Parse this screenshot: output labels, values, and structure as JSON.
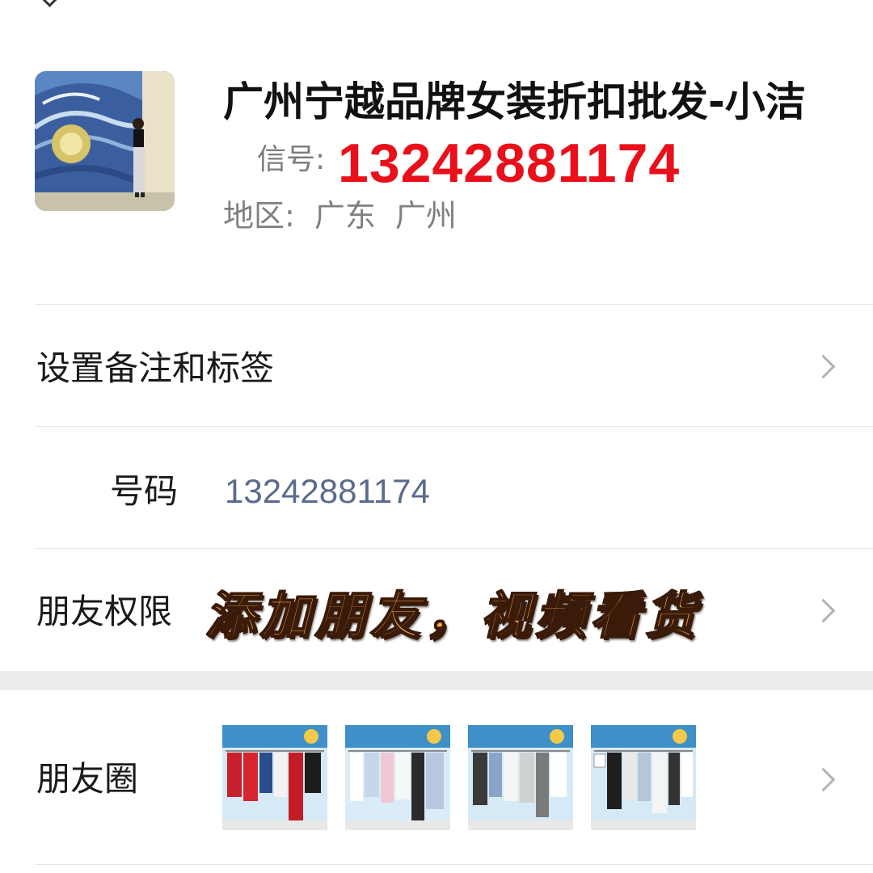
{
  "profile": {
    "name": "广州宁越品牌女装折扣批发-小洁",
    "signal_label": "信号:",
    "signal_value": "13242881174",
    "region_label": "地区:",
    "region_province": "广东",
    "region_city": "广州",
    "avatar_icon": "avatar-starry-night-photo"
  },
  "rows": {
    "remark_label": "设置备注和标签",
    "phone_label": "号码",
    "phone_value": "13242881174",
    "permission_label": "朋友权限",
    "promo_text": "添加朋友，视频看货",
    "moments_label": "朋友圈"
  },
  "moments": {
    "thumbnails": [
      "clothing-rack-photo-1",
      "clothing-rack-photo-2",
      "clothing-rack-photo-3",
      "clothing-rack-photo-4"
    ]
  },
  "colors": {
    "accent_red": "#e8101a",
    "phone_link": "#5a6b8c",
    "promo_fill": "#f6b24a"
  }
}
